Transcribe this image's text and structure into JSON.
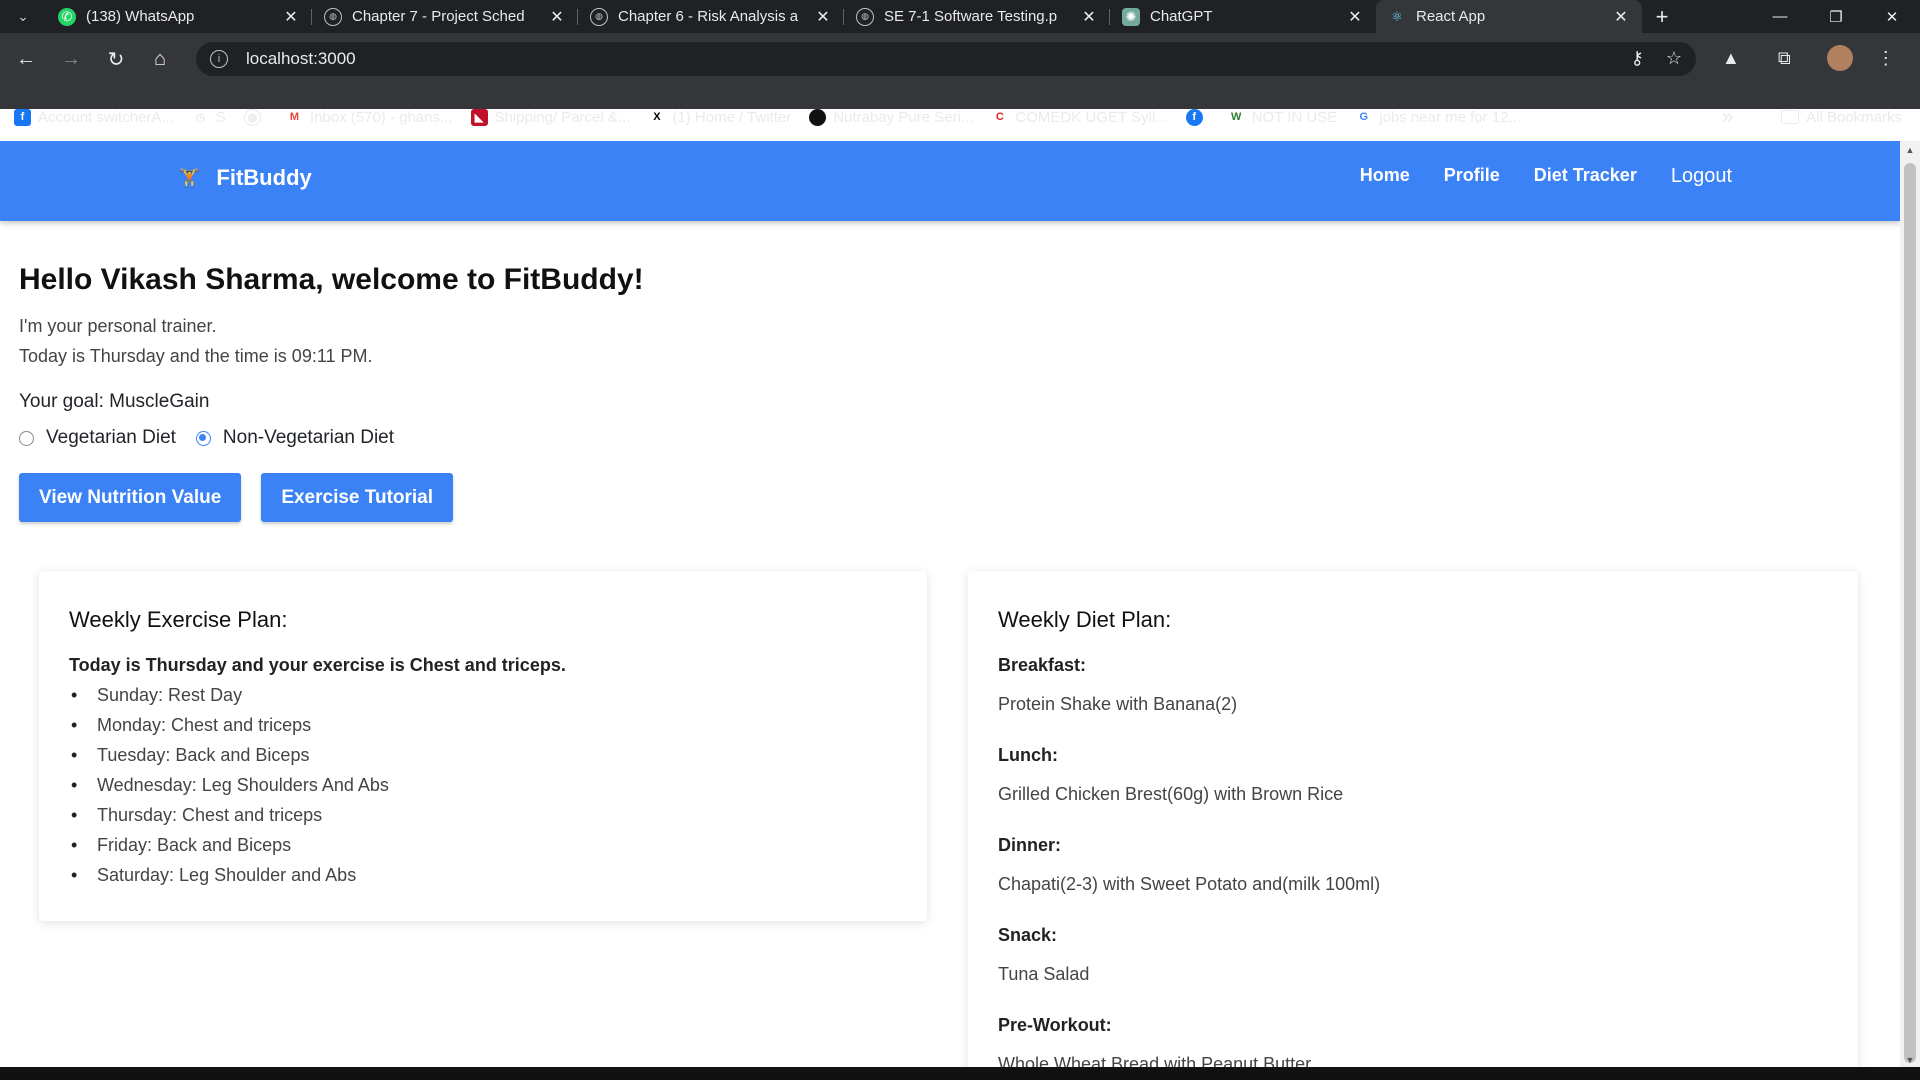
{
  "browser": {
    "tabs": [
      {
        "title": "(138) WhatsApp",
        "icon": "whatsapp-icon",
        "active": false
      },
      {
        "title": "Chapter 7 - Project Sched",
        "icon": "globe-icon",
        "active": false
      },
      {
        "title": "Chapter 6 - Risk Analysis a",
        "icon": "globe-icon",
        "active": false
      },
      {
        "title": "SE 7-1 Software Testing.p",
        "icon": "globe-icon",
        "active": false
      },
      {
        "title": "ChatGPT",
        "icon": "chatgpt-icon",
        "active": false
      },
      {
        "title": "React App",
        "icon": "react-icon",
        "active": true
      }
    ],
    "url": "localhost:3000",
    "bookmarks": [
      {
        "label": "Account switcherA...",
        "icon": "facebook-icon"
      },
      {
        "label": "S",
        "icon": "history-icon"
      },
      {
        "label": "",
        "icon": "globe-icon"
      },
      {
        "label": "Inbox (570) - ghans...",
        "icon": "gmail-icon"
      },
      {
        "label": "Shipping/ Parcel &...",
        "icon": "parcel-icon"
      },
      {
        "label": "(1) Home / Twitter",
        "icon": "x-icon"
      },
      {
        "label": "Nutrabay Pure Seri...",
        "icon": "nutrabay-icon"
      },
      {
        "label": "COMEDK UGET Syll...",
        "icon": "comedk-icon"
      },
      {
        "label": "",
        "icon": "facebook-icon"
      },
      {
        "label": "NOT IN USE",
        "icon": "w-icon"
      },
      {
        "label": "jobs near me for 12...",
        "icon": "google-icon"
      }
    ],
    "all_bookmarks": "All Bookmarks",
    "overflow": "»"
  },
  "app": {
    "brand": "FitBuddy",
    "nav": {
      "home": "Home",
      "profile": "Profile",
      "diet": "Diet Tracker",
      "logout": "Logout"
    },
    "greeting": "Hello Vikash Sharma, welcome to FitBuddy!",
    "trainer_line": "I'm your personal trainer.",
    "time_line": "Today is Thursday and the time is 09:11 PM.",
    "goal_line": "Your goal: MuscleGain",
    "diet_options": {
      "veg": "Vegetarian Diet",
      "nonveg": "Non-Vegetarian Diet",
      "selected": "Non-Vegetarian Diet"
    },
    "buttons": {
      "nutrition": "View Nutrition Value",
      "tutorial": "Exercise Tutorial"
    },
    "exercise": {
      "heading": "Weekly Exercise Plan:",
      "today": "Today is Thursday and your exercise is Chest and triceps.",
      "days": [
        "Sunday: Rest Day",
        "Monday: Chest and triceps",
        "Tuesday: Back and Biceps",
        "Wednesday: Leg Shoulders And Abs",
        "Thursday: Chest and triceps",
        "Friday: Back and Biceps",
        "Saturday: Leg Shoulder and Abs"
      ]
    },
    "diet": {
      "heading": "Weekly Diet Plan:",
      "breakfast_h": "Breakfast:",
      "breakfast": "Protein Shake with Banana(2)",
      "lunch_h": "Lunch:",
      "lunch": "Grilled Chicken Brest(60g) with Brown Rice",
      "dinner_h": "Dinner:",
      "dinner": "Chapati(2-3) with Sweet Potato and(milk 100ml)",
      "snack_h": "Snack:",
      "snack": "Tuna Salad",
      "preworkout_h": "Pre-Workout:",
      "preworkout": "Whole Wheat Bread with Peanut Butter"
    }
  },
  "colors": {
    "accent": "#3b82f6",
    "chrome_dark": "#202124",
    "chrome": "#35363a"
  }
}
